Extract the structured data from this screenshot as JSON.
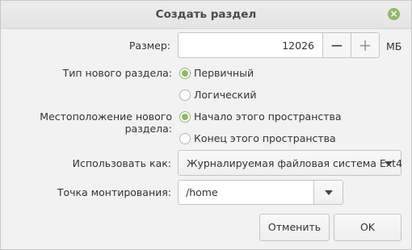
{
  "dialog": {
    "title": "Создать раздел",
    "close_icon": "close-icon",
    "accent_color": "#8fb867"
  },
  "size": {
    "label": "Размер:",
    "value": "12026",
    "minus": "−",
    "plus": "+",
    "unit": "МБ"
  },
  "partition_type": {
    "label": "Тип нового раздела:",
    "options": [
      {
        "label": "Первичный",
        "checked": true
      },
      {
        "label": "Логический",
        "checked": false
      }
    ]
  },
  "location": {
    "label": "Местоположение нового раздела:",
    "options": [
      {
        "label": "Начало этого пространства",
        "checked": true
      },
      {
        "label": "Конец этого пространства",
        "checked": false
      }
    ]
  },
  "use_as": {
    "label": "Использовать как:",
    "selected": "Журналируемая файловая система Ext4"
  },
  "mount_point": {
    "label": "Точка монтирования:",
    "value": "/home"
  },
  "buttons": {
    "cancel": "Отменить",
    "ok": "OK"
  }
}
